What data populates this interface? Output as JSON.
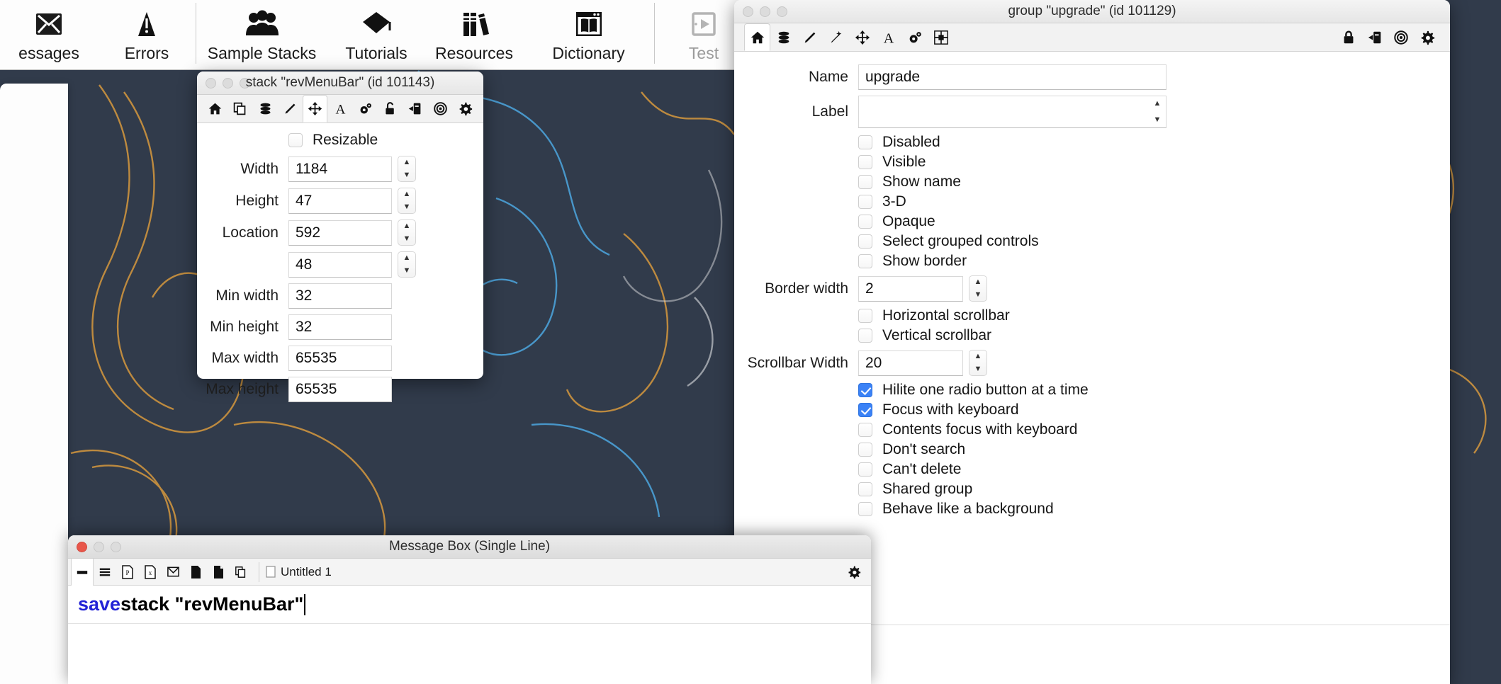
{
  "ide_toolbar": {
    "items": [
      {
        "label": "essages",
        "icon": "messages-icon",
        "dim": false
      },
      {
        "label": "Errors",
        "icon": "errors-icon",
        "dim": false
      },
      {
        "label": "Sample Stacks",
        "icon": "sample-stacks-icon",
        "dim": false
      },
      {
        "label": "Tutorials",
        "icon": "tutorials-icon",
        "dim": false
      },
      {
        "label": "Resources",
        "icon": "resources-icon",
        "dim": false
      },
      {
        "label": "Dictionary",
        "icon": "dictionary-icon",
        "dim": false
      },
      {
        "label": "Test",
        "icon": "test-icon",
        "dim": true
      }
    ]
  },
  "stack_inspector": {
    "title": "stack \"revMenuBar\" (id 101143)",
    "tabs": [
      {
        "name": "basic-tab",
        "icon": "home-icon",
        "active": false
      },
      {
        "name": "copy-tab",
        "icon": "copy-icon",
        "active": false
      },
      {
        "name": "database-tab",
        "icon": "database-icon",
        "active": false
      },
      {
        "name": "edit-tab",
        "icon": "pencil-icon",
        "active": false
      },
      {
        "name": "size-position-tab",
        "icon": "move-icon",
        "active": true
      },
      {
        "name": "text-tab",
        "icon": "text-a-icon",
        "active": false
      },
      {
        "name": "custom-tab",
        "icon": "gears-icon",
        "active": false
      }
    ],
    "right_tabs": [
      {
        "name": "lock-tab",
        "icon": "unlock-icon"
      },
      {
        "name": "transition-tab",
        "icon": "transition-icon"
      },
      {
        "name": "target-tab",
        "icon": "target-icon"
      },
      {
        "name": "settings-tab",
        "icon": "gear-icon"
      }
    ],
    "resizable": {
      "label": "Resizable",
      "checked": false
    },
    "fields": [
      {
        "label": "Width",
        "value": "1184",
        "stepper": true
      },
      {
        "label": "Height",
        "value": "47",
        "stepper": true
      },
      {
        "label": "Location",
        "value": "592",
        "stepper": true
      },
      {
        "label": "",
        "value": "48",
        "stepper": true
      },
      {
        "label": "Min width",
        "value": "32",
        "stepper": false
      },
      {
        "label": "Min height",
        "value": "32",
        "stepper": false
      },
      {
        "label": "Max width",
        "value": "65535",
        "stepper": false
      },
      {
        "label": "Max height",
        "value": "65535",
        "stepper": false
      }
    ]
  },
  "group_inspector": {
    "title": "group \"upgrade\" (id 101129)",
    "tabs": [
      {
        "name": "basic-tab",
        "icon": "home-icon",
        "active": true
      },
      {
        "name": "database-tab",
        "icon": "database-icon",
        "active": false
      },
      {
        "name": "edit-tab",
        "icon": "pencil-icon",
        "active": false
      },
      {
        "name": "effects-tab",
        "icon": "wand-icon",
        "active": false
      },
      {
        "name": "size-position-tab",
        "icon": "move-icon",
        "active": false
      },
      {
        "name": "text-tab",
        "icon": "text-a-icon",
        "active": false
      },
      {
        "name": "custom-tab",
        "icon": "gears-icon",
        "active": false
      },
      {
        "name": "align-tab",
        "icon": "align-icon",
        "active": false
      }
    ],
    "right_tabs": [
      {
        "name": "lock-tab",
        "icon": "lock-icon"
      },
      {
        "name": "transition-tab",
        "icon": "transition-icon"
      },
      {
        "name": "target-tab",
        "icon": "target-icon"
      },
      {
        "name": "settings-tab",
        "icon": "gear-icon"
      }
    ],
    "name_label": "Name",
    "name_value": "upgrade",
    "label_label": "Label",
    "label_value": "",
    "checkboxes_top": [
      {
        "label": "Disabled",
        "checked": false
      },
      {
        "label": "Visible",
        "checked": false
      },
      {
        "label": "Show name",
        "checked": false
      },
      {
        "label": "3-D",
        "checked": false
      },
      {
        "label": "Opaque",
        "checked": false
      },
      {
        "label": "Select grouped controls",
        "checked": false
      },
      {
        "label": "Show border",
        "checked": false
      }
    ],
    "border_width_label": "Border width",
    "border_width_value": "2",
    "scrollbars": [
      {
        "label": "Horizontal scrollbar",
        "checked": false
      },
      {
        "label": "Vertical scrollbar",
        "checked": false
      }
    ],
    "scrollbar_width_label": "Scrollbar Width",
    "scrollbar_width_value": "20",
    "checkboxes_bottom": [
      {
        "label": "Hilite one radio button at a time",
        "checked": true
      },
      {
        "label": "Focus with keyboard",
        "checked": true
      },
      {
        "label": "Contents focus with keyboard",
        "checked": false
      },
      {
        "label": "Don't search",
        "checked": false
      },
      {
        "label": "Can't delete",
        "checked": false
      },
      {
        "label": "Shared group",
        "checked": false
      },
      {
        "label": "Behave like a background",
        "checked": false
      }
    ]
  },
  "message_box": {
    "title": "Message Box (Single Line)",
    "toolbar_icons": [
      {
        "name": "single-line-tab",
        "icon": "single-line-icon",
        "active": true
      },
      {
        "name": "multi-line-tab",
        "icon": "multi-line-icon",
        "active": false
      },
      {
        "name": "global-props-tab",
        "icon": "global-properties-icon",
        "active": false
      },
      {
        "name": "global-vars-tab",
        "icon": "global-variables-icon",
        "active": false
      },
      {
        "name": "pending-messages-tab",
        "icon": "pending-messages-icon",
        "active": false
      },
      {
        "name": "front-scripts-tab",
        "icon": "front-scripts-icon",
        "active": false
      },
      {
        "name": "back-scripts-tab",
        "icon": "back-scripts-icon",
        "active": false
      },
      {
        "name": "copy-tab",
        "icon": "copy-icon",
        "active": false
      }
    ],
    "document_label": "Untitled 1",
    "command_keyword": "save",
    "command_rest": " stack \"revMenuBar\""
  },
  "colors": {
    "accent_blue": "#3b82f6",
    "keyword_blue": "#2323d6",
    "desktop_dark": "#313b4b",
    "line_orange": "#c9913f",
    "line_blue": "#3f93c9"
  }
}
